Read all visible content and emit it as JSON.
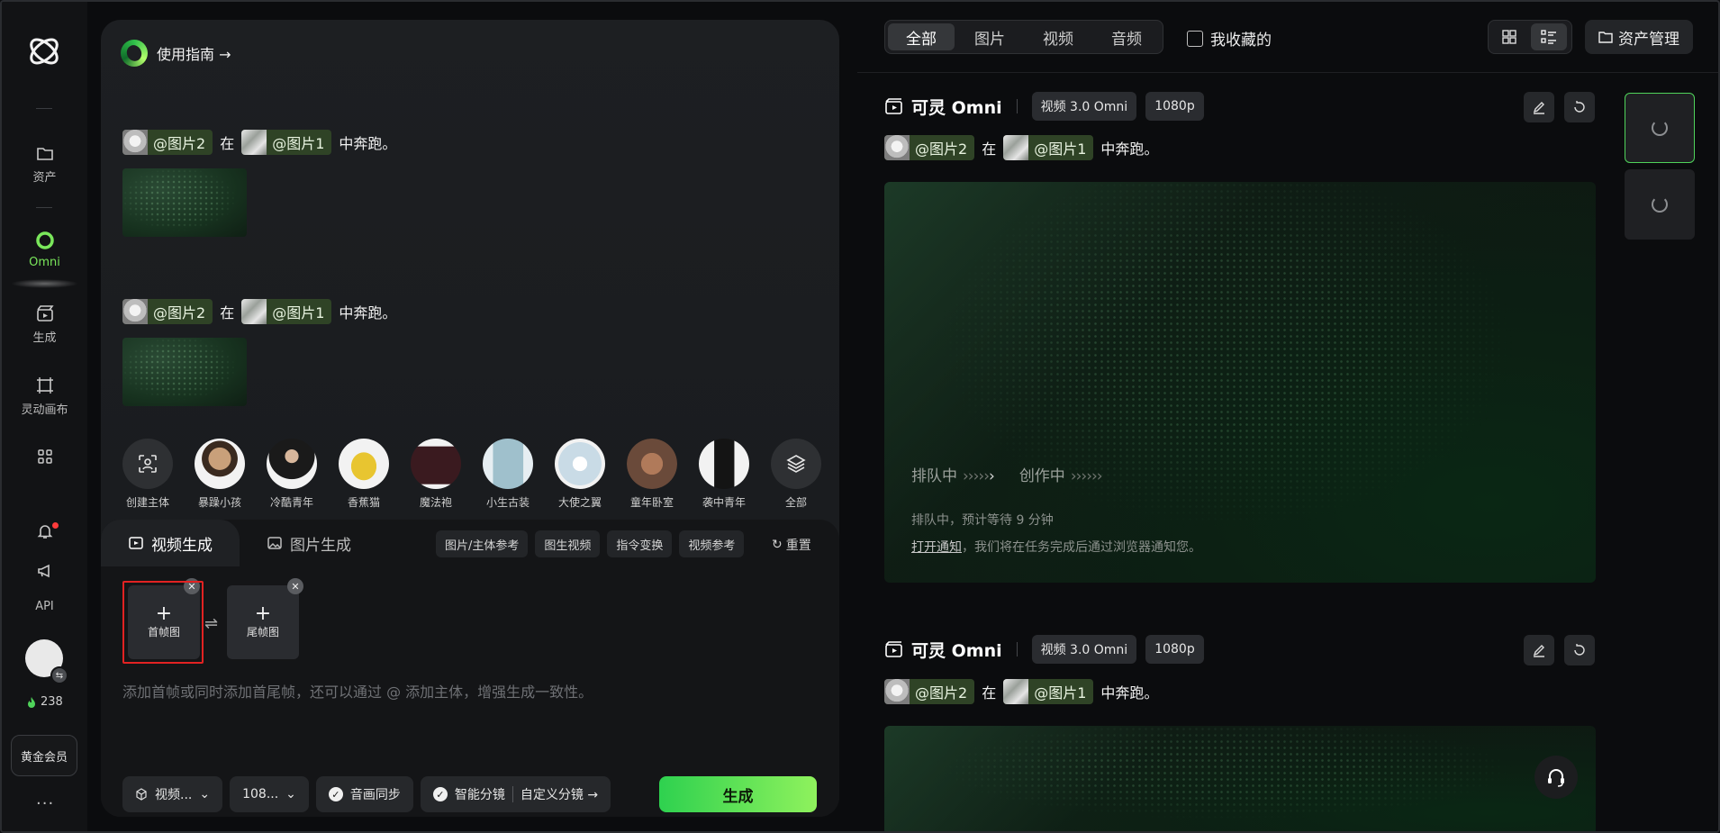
{
  "rail": {
    "items": [
      {
        "label": "资产",
        "icon": "folder-icon"
      },
      {
        "label": "Omni",
        "icon": "omni-ring-icon"
      },
      {
        "label": "生成",
        "icon": "clapper-icon"
      },
      {
        "label": "灵动画布",
        "icon": "canvas-icon"
      }
    ],
    "api_label": "API",
    "credits": "238",
    "membership": "黄金会员",
    "more": "···"
  },
  "panel": {
    "guide": "使用指南 →",
    "prompts": [
      {
        "chip1": "@图片2",
        "mid": "在",
        "chip2": "@图片1",
        "tail": "中奔跑。"
      },
      {
        "chip1": "@图片2",
        "mid": "在",
        "chip2": "@图片1",
        "tail": "中奔跑。"
      }
    ],
    "subjects": [
      {
        "label": "创建主体"
      },
      {
        "label": "暴躁小孩"
      },
      {
        "label": "冷酷青年"
      },
      {
        "label": "香蕉猫"
      },
      {
        "label": "魔法袍"
      },
      {
        "label": "小生古装"
      },
      {
        "label": "大使之翼"
      },
      {
        "label": "童年卧室"
      },
      {
        "label": "袭中青年"
      },
      {
        "label": "全部"
      }
    ],
    "tabs": [
      {
        "label": "视频生成",
        "active": true
      },
      {
        "label": "图片生成",
        "active": false
      }
    ],
    "mini_buttons": [
      "图片/主体参考",
      "图生视频",
      "指令变换",
      "视频参考"
    ],
    "reset": "重置",
    "first_frame": "首帧图",
    "last_frame": "尾帧图",
    "hint": "添加首帧或同时添加首尾帧，还可以通过 @ 添加主体，增强生成一致性。",
    "bottom": {
      "model": "视频...",
      "resolution": "108...",
      "audio_sync": "音画同步",
      "smart_shot": "智能分镜",
      "custom_shot": "自定义分镜 →",
      "generate": "生成"
    }
  },
  "topbar": {
    "segments": [
      {
        "label": "全部",
        "active": true
      },
      {
        "label": "图片",
        "active": false
      },
      {
        "label": "视频",
        "active": false
      },
      {
        "label": "音频",
        "active": false
      }
    ],
    "favorites": "我收藏的",
    "asset_manager": "资产管理"
  },
  "cards": [
    {
      "title": "可灵 Omni",
      "model": "视频 3.0 Omni",
      "resolution": "1080p",
      "prompt": {
        "chip1": "@图片2",
        "mid": "在",
        "chip2": "@图片1",
        "tail": "中奔跑。"
      },
      "status_queue": "排队中",
      "status_create": "创作中",
      "wait": "排队中，预计等待 9 分钟",
      "notify_link": "打开通知",
      "notify_rest": "，我们将在任务完成后通过浏览器通知您。"
    },
    {
      "title": "可灵 Omni",
      "model": "视频 3.0 Omni",
      "resolution": "1080p",
      "prompt": {
        "chip1": "@图片2",
        "mid": "在",
        "chip2": "@图片1",
        "tail": "中奔跑。"
      }
    }
  ],
  "colors": {
    "accent": "#7ae75b",
    "generate_gradient_start": "#2ed14f",
    "generate_gradient_end": "#8ff25d",
    "highlight_red": "#e22222"
  }
}
